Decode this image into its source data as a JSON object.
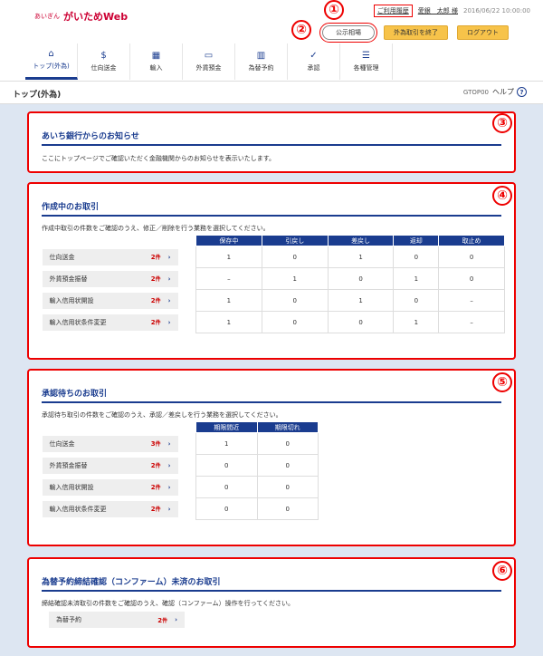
{
  "header": {
    "bank_name": "あいぎん",
    "brand": "がいためWeb",
    "usage_link": "ご利用履歴",
    "user_name": "愛銀　太郎 様",
    "datetime": "2016/06/22 10:00:00",
    "rate_button": "公示相場",
    "end_button": "外為取引を終了",
    "logout_button": "ログアウト"
  },
  "nav": {
    "items": [
      {
        "label": "トップ(外為)",
        "icon": "home-icon"
      },
      {
        "label": "仕向送金",
        "icon": "remittance-icon"
      },
      {
        "label": "輸入",
        "icon": "import-icon"
      },
      {
        "label": "外貨預金",
        "icon": "deposit-icon"
      },
      {
        "label": "為替予約",
        "icon": "forex-reserve-icon"
      },
      {
        "label": "承認",
        "icon": "approval-icon"
      },
      {
        "label": "各種管理",
        "icon": "management-icon"
      }
    ]
  },
  "page": {
    "title": "トップ(外為)",
    "code": "GTOP00",
    "help": "ヘルプ"
  },
  "annotations": [
    "①",
    "②",
    "③",
    "④",
    "⑤",
    "⑥"
  ],
  "notice": {
    "title": "あいち銀行からのお知らせ",
    "desc": "ここにトップページでご確認いただく金融機関からのお知らせを表示いたします。"
  },
  "drafts": {
    "title": "作成中のお取引",
    "desc": "作成中取引の件数をご確認のうえ、修正／削除を行う業務を選択してください。",
    "columns": [
      "保存中",
      "引戻し",
      "差戻し",
      "返却",
      "取止め"
    ],
    "rows": [
      {
        "name": "仕向送金",
        "count": "2",
        "unit": "件",
        "values": [
          "1",
          "0",
          "1",
          "0",
          "0"
        ]
      },
      {
        "name": "外貨預金振替",
        "count": "2",
        "unit": "件",
        "values": [
          "–",
          "1",
          "0",
          "1",
          "0"
        ]
      },
      {
        "name": "輸入信用状開設",
        "count": "2",
        "unit": "件",
        "values": [
          "1",
          "0",
          "1",
          "0",
          "–"
        ]
      },
      {
        "name": "輸入信用状条件変更",
        "count": "2",
        "unit": "件",
        "values": [
          "1",
          "0",
          "0",
          "1",
          "–"
        ]
      }
    ]
  },
  "approvals": {
    "title": "承認待ちのお取引",
    "desc": "承認待ち取引の件数をご確認のうえ、承認／差戻しを行う業務を選択してください。",
    "columns": [
      "期限間近",
      "期限切れ"
    ],
    "rows": [
      {
        "name": "仕向送金",
        "count": "3",
        "unit": "件",
        "values": [
          "1",
          "0"
        ]
      },
      {
        "name": "外貨預金振替",
        "count": "2",
        "unit": "件",
        "values": [
          "0",
          "0"
        ]
      },
      {
        "name": "輸入信用状開設",
        "count": "2",
        "unit": "件",
        "values": [
          "0",
          "0"
        ]
      },
      {
        "name": "輸入信用状条件変更",
        "count": "2",
        "unit": "件",
        "values": [
          "0",
          "0"
        ]
      }
    ]
  },
  "confirm": {
    "title": "為替予約締結確認（コンファーム）未済のお取引",
    "desc": "締結確認未済取引の件数をご確認のうえ、確認（コンファーム）操作を行ってください。",
    "rows": [
      {
        "name": "為替予約",
        "count": "2",
        "unit": "件"
      }
    ]
  }
}
